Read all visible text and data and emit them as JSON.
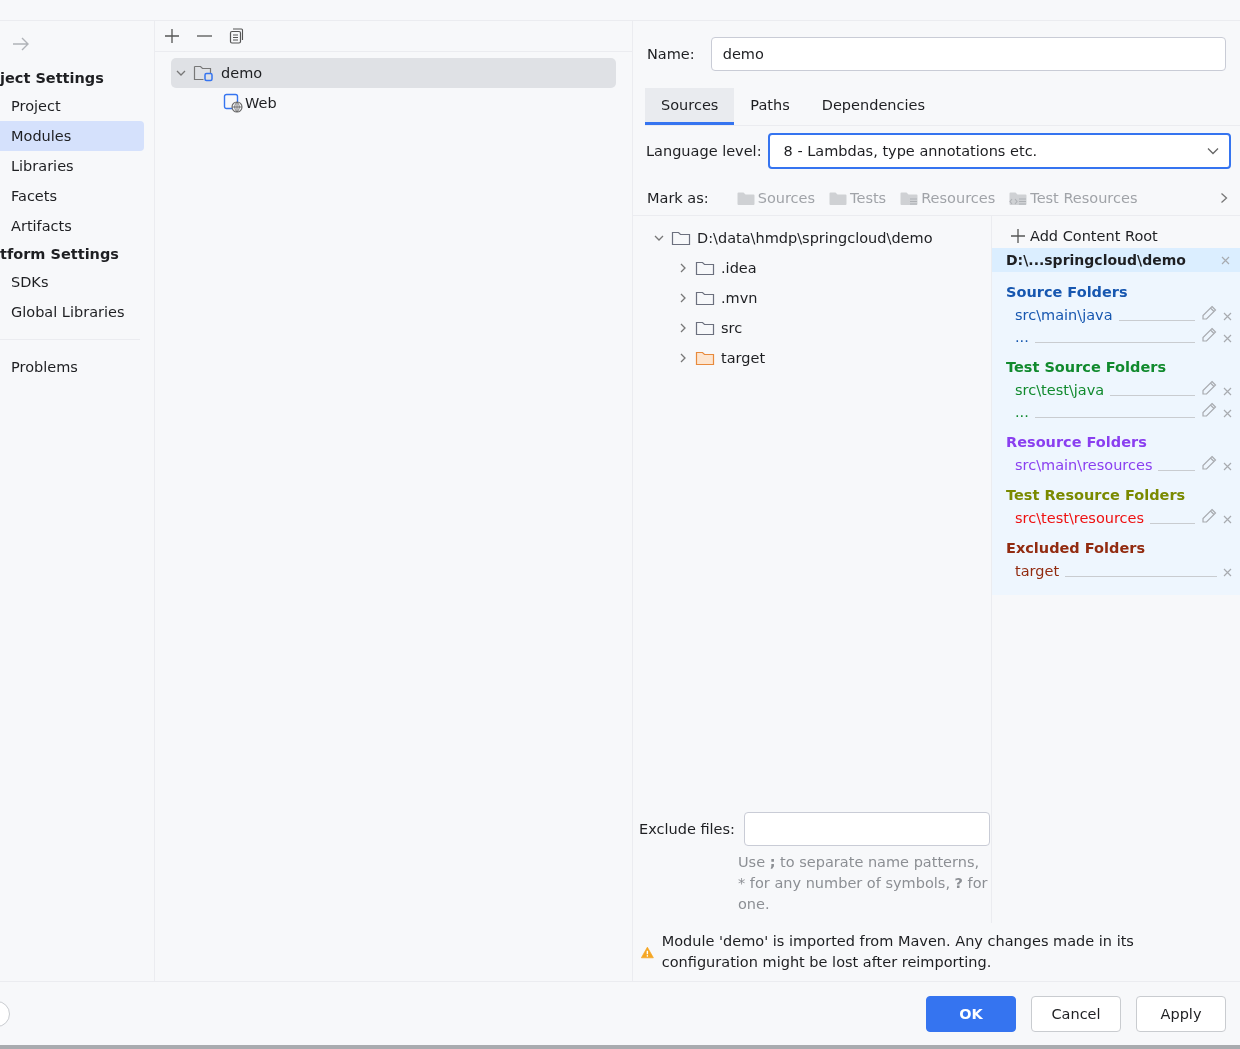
{
  "sidebar": {
    "sections": [
      {
        "title": "ject Settings",
        "items": [
          {
            "label": "Project",
            "selected": false
          },
          {
            "label": "Modules",
            "selected": true
          },
          {
            "label": "Libraries",
            "selected": false
          },
          {
            "label": "Facets",
            "selected": false
          },
          {
            "label": "Artifacts",
            "selected": false
          }
        ]
      },
      {
        "title": "tform Settings",
        "items": [
          {
            "label": "SDKs",
            "selected": false
          },
          {
            "label": "Global Libraries",
            "selected": false
          }
        ]
      }
    ],
    "problems": "Problems"
  },
  "module_tree": [
    {
      "label": "demo",
      "kind": "module",
      "expanded": true,
      "selected": true,
      "children": [
        {
          "label": "Web",
          "kind": "web",
          "selected": false
        }
      ]
    }
  ],
  "name_field": {
    "label": "Name:",
    "value": "demo"
  },
  "tabs": [
    {
      "label": "Sources",
      "selected": true
    },
    {
      "label": "Paths",
      "selected": false
    },
    {
      "label": "Dependencies",
      "selected": false
    }
  ],
  "language_level": {
    "label": "Language level:",
    "value": "8 - Lambdas, type annotations etc."
  },
  "mark_as": {
    "label": "Mark as:",
    "options": [
      {
        "label": "Sources",
        "kind": "folder"
      },
      {
        "label": "Tests",
        "kind": "folder"
      },
      {
        "label": "Resources",
        "kind": "resources"
      },
      {
        "label": "Test Resources",
        "kind": "test-resources"
      }
    ]
  },
  "file_tree": [
    {
      "label": "D:\\data\\hmdp\\springcloud\\demo",
      "expanded": true,
      "children": [
        {
          "label": ".idea",
          "kind": "folder",
          "expanded": false
        },
        {
          "label": ".mvn",
          "kind": "folder",
          "expanded": false
        },
        {
          "label": "src",
          "kind": "folder",
          "expanded": false
        },
        {
          "label": "target",
          "kind": "excluded",
          "expanded": false
        }
      ]
    }
  ],
  "content_root": {
    "add_label": "Add Content Root",
    "path": "D:\\...springcloud\\demo",
    "groups": [
      {
        "title": "Source Folders",
        "color": "#1757b0",
        "entries": [
          {
            "path": "src\\main\\java",
            "color": "#1757b0",
            "editable": true
          },
          {
            "path": "...",
            "color": "#1757b0",
            "editable": true
          }
        ]
      },
      {
        "title": "Test Source Folders",
        "color": "#118a2e",
        "entries": [
          {
            "path": "src\\test\\java",
            "color": "#118a2e",
            "editable": true
          },
          {
            "path": "...",
            "color": "#118a2e",
            "editable": true
          }
        ]
      },
      {
        "title": "Resource Folders",
        "color": "#8a3ff0",
        "entries": [
          {
            "path": "src\\main\\resources",
            "color": "#8a3ff0",
            "editable": true
          }
        ]
      },
      {
        "title": "Test Resource Folders",
        "color": "#7a8a00",
        "entries": [
          {
            "path": "src\\test\\resources",
            "color": "#ee1111",
            "editable": true
          }
        ]
      },
      {
        "title": "Excluded Folders",
        "color": "#922b10",
        "entries": [
          {
            "path": "target",
            "color": "#922b10",
            "editable": false
          }
        ]
      }
    ]
  },
  "exclude_files": {
    "label": "Exclude files:",
    "hint": "Use **;** to separate name patterns, * for any number of symbols, **?** for one."
  },
  "warning": "Module 'demo' is imported from Maven. Any changes made in its configuration might be lost after reimporting.",
  "buttons": [
    {
      "label": "OK",
      "kind": "primary"
    },
    {
      "label": "Cancel",
      "kind": "normal"
    },
    {
      "label": "Apply",
      "kind": "normal"
    }
  ]
}
